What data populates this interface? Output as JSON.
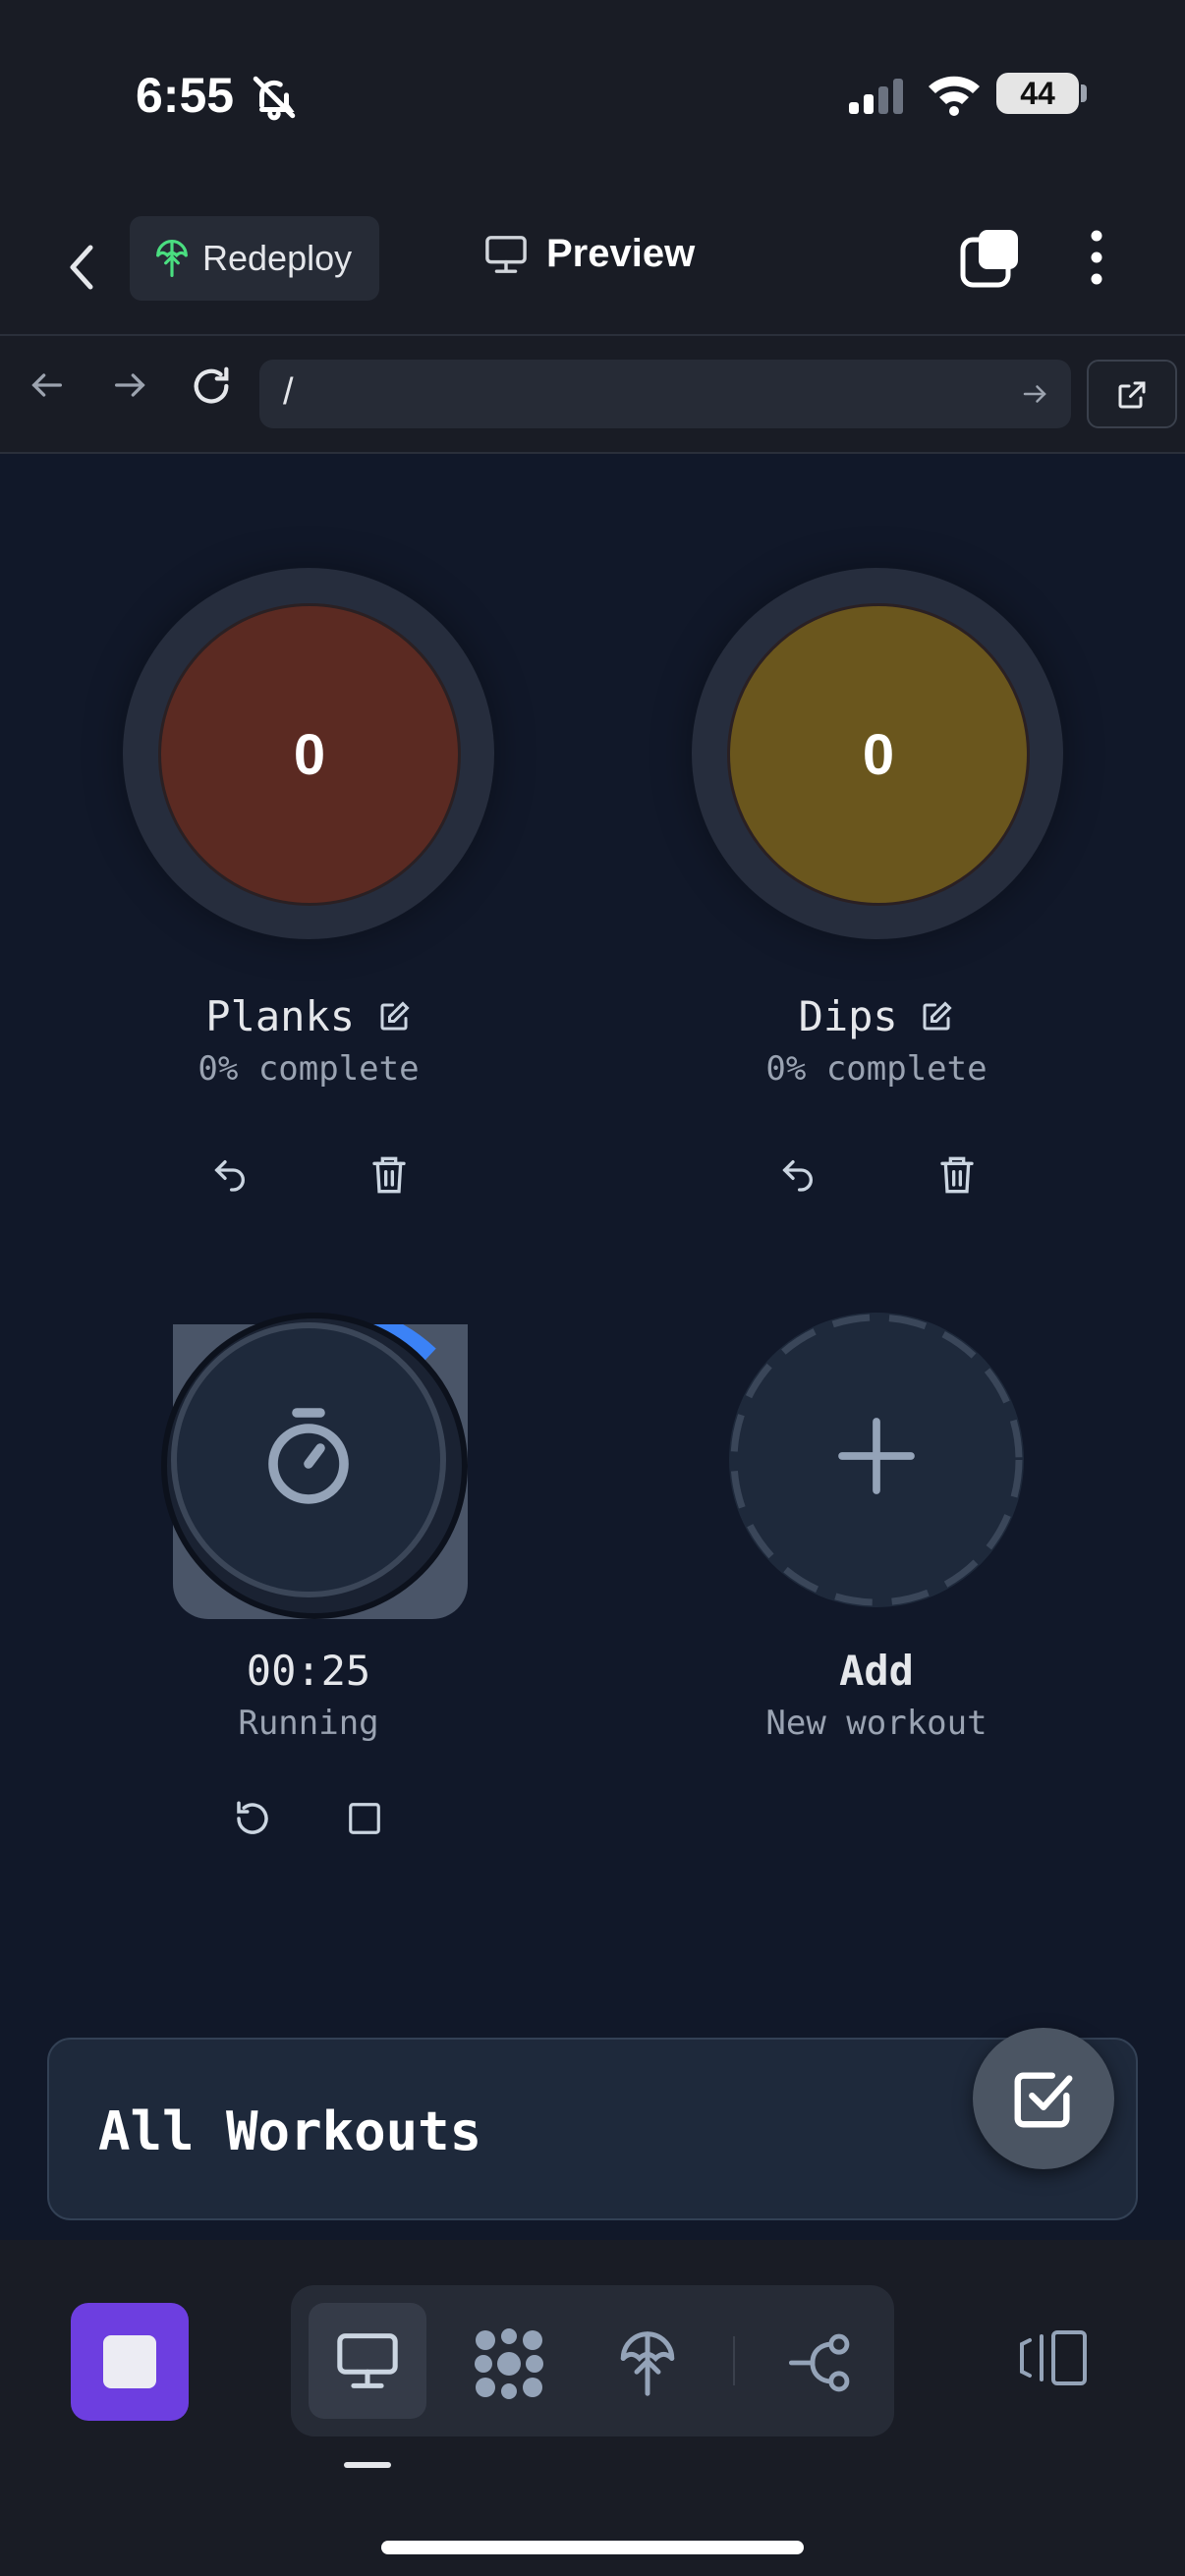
{
  "status_bar": {
    "time": "6:55",
    "battery": "44"
  },
  "nav": {
    "redeploy_label": "Redeploy",
    "preview_label": "Preview"
  },
  "url_bar": {
    "path": "/"
  },
  "workouts": [
    {
      "count": "0",
      "name": "Planks",
      "progress": "0% complete",
      "color": "#5b2a22"
    },
    {
      "count": "0",
      "name": "Dips",
      "progress": "0% complete",
      "color": "#6a561d"
    }
  ],
  "timer": {
    "time": "00:25",
    "status": "Running",
    "progress_fraction": 0.12
  },
  "add_tile": {
    "title": "Add",
    "subtitle": "New workout"
  },
  "panel": {
    "title": "All Workouts"
  },
  "colors": {
    "accent": "#6d3ee0",
    "timer_progress": "#3b82f6"
  }
}
